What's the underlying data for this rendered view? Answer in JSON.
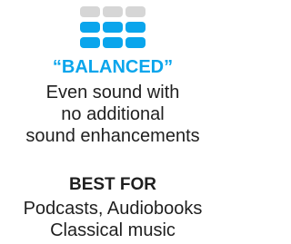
{
  "mode": {
    "title": "“BALANCED”",
    "description_lines": [
      "Even sound with",
      "no additional",
      "sound enhancements"
    ]
  },
  "best_for": {
    "heading": "BEST FOR",
    "items": [
      "Podcasts, Audiobooks",
      "Classical music"
    ]
  },
  "icon": {
    "name": "equalizer-balanced-icon",
    "rows": 3,
    "columns": 3,
    "inactive_rows": 1,
    "active_color": "#0aa5ec",
    "inactive_color": "#d6d6d6"
  },
  "colors": {
    "accent": "#0aa5ec",
    "text": "#1f1f1f",
    "background": "#ffffff"
  }
}
